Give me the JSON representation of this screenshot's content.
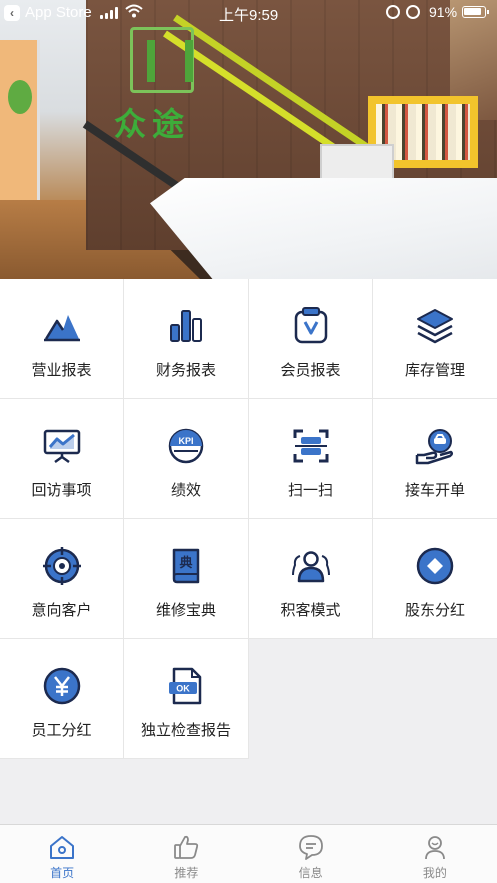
{
  "status_bar": {
    "back_label": "App Store",
    "time": "上午9:59",
    "battery_percent": "91%",
    "battery_level": 0.91
  },
  "banner": {
    "logo_text": "众途"
  },
  "menu": [
    {
      "label": "营业报表",
      "icon": "mountain-chart-icon"
    },
    {
      "label": "财务报表",
      "icon": "bar-chart-icon"
    },
    {
      "label": "会员报表",
      "icon": "member-card-icon"
    },
    {
      "label": "库存管理",
      "icon": "stacked-layers-icon"
    },
    {
      "label": "回访事项",
      "icon": "presentation-board-icon"
    },
    {
      "label": "绩效",
      "icon": "kpi-icon"
    },
    {
      "label": "扫一扫",
      "icon": "scan-icon"
    },
    {
      "label": "接车开单",
      "icon": "car-hand-icon"
    },
    {
      "label": "意向客户",
      "icon": "target-icon"
    },
    {
      "label": "维修宝典",
      "icon": "dictionary-book-icon"
    },
    {
      "label": "积客模式",
      "icon": "customers-icon"
    },
    {
      "label": "股东分红",
      "icon": "diamond-icon"
    },
    {
      "label": "员工分红",
      "icon": "yen-coin-icon"
    },
    {
      "label": "独立检查报告",
      "icon": "ok-document-icon"
    }
  ],
  "tabbar": {
    "items": [
      {
        "label": "首页",
        "icon": "home-icon",
        "active": true
      },
      {
        "label": "推荐",
        "icon": "thumbs-up-icon",
        "active": false
      },
      {
        "label": "信息",
        "icon": "message-bubble-icon",
        "active": false
      },
      {
        "label": "我的",
        "icon": "user-icon",
        "active": false
      }
    ]
  },
  "colors": {
    "primary_blue": "#3b74c9",
    "dark_navy": "#1c2a4f",
    "active_tab": "#3b74c9",
    "inactive_tab": "#8a8a8a"
  }
}
